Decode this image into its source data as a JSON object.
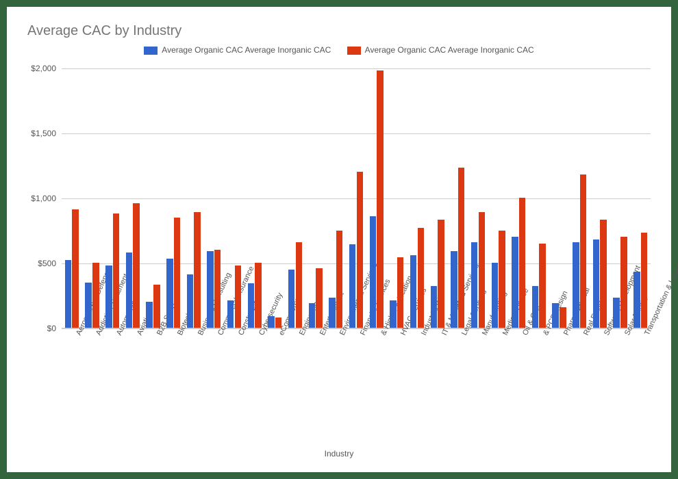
{
  "chart_data": {
    "type": "bar",
    "title": "Average CAC by Industry",
    "xlabel": "Industry",
    "ylabel": "",
    "ylim": [
      0,
      2000
    ],
    "yticks": [
      0,
      500,
      1000,
      1500,
      2000
    ],
    "ytick_labels": [
      "$0",
      "$500",
      "$1,000",
      "$1,500",
      "$2,000"
    ],
    "legend": [
      "Average Organic CAC Average Inorganic CAC",
      "Average Organic CAC Average Inorganic CAC"
    ],
    "colors": {
      "series1": "#3366cc",
      "series2": "#dc3912"
    },
    "categories": [
      "Aerospace & Defense",
      "Addiction Treatment",
      "Automotive",
      "Aviation",
      "B2B SaaS",
      "Biotech",
      "Business Consulting",
      "Commercial Insurance",
      "Construction",
      "Cybersecurity",
      "eCommerce",
      "Engineering",
      "Entertainment",
      "Environmental Services",
      "Financial Services",
      "Higher Education &",
      "HVAC Services",
      "Industrial IoT",
      "IT & Managed Services",
      "Legal Services",
      "Manufacturing",
      "Medical Device",
      "Oil & Gas",
      "PCB Design &",
      "Pharmaceutical",
      "Real Estate",
      "Software Development",
      "Solar Energy",
      "Transportation & Logistics"
    ],
    "series": [
      {
        "name": "Average Organic CAC Average Inorganic CAC",
        "values": [
          520,
          350,
          480,
          580,
          200,
          530,
          410,
          590,
          210,
          340,
          90,
          450,
          190,
          230,
          640,
          860,
          210,
          560,
          320,
          590,
          660,
          500,
          700,
          320,
          190,
          660,
          680,
          230,
          430
        ]
      },
      {
        "name": "Average Organic CAC Average Inorganic CAC",
        "values": [
          910,
          500,
          880,
          960,
          330,
          850,
          890,
          600,
          480,
          500,
          80,
          660,
          460,
          750,
          1200,
          1980,
          540,
          770,
          830,
          1230,
          890,
          750,
          1000,
          650,
          160,
          1180,
          830,
          700,
          730
        ]
      }
    ]
  }
}
